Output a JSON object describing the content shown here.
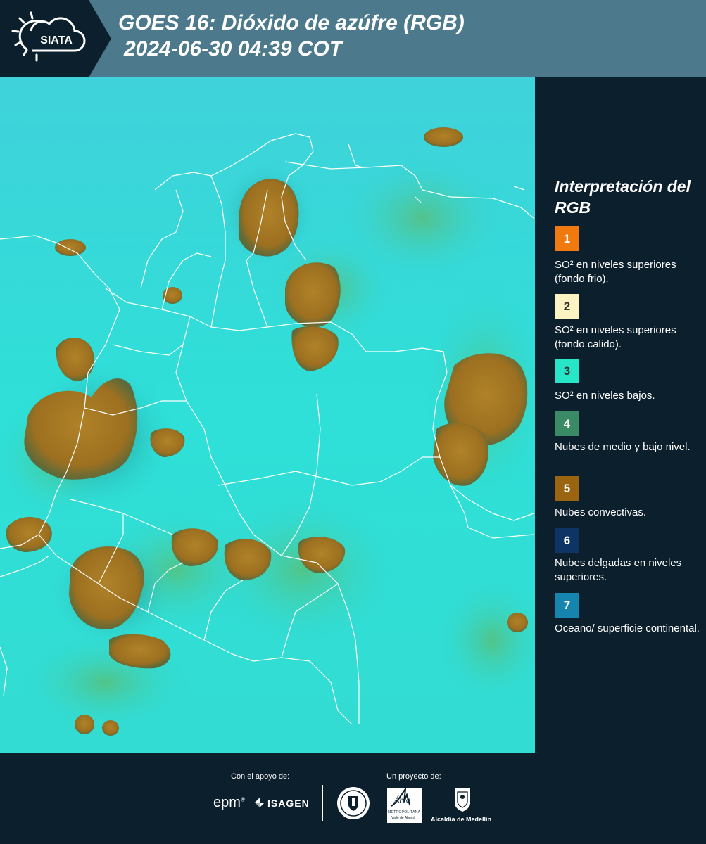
{
  "header": {
    "logo_text": "SIATA",
    "title_line1": "GOES 16: Dióxido de azúfre (RGB)",
    "title_line2": "2024-06-30 04:39 COT"
  },
  "legend": {
    "title": "Interpretación del RGB",
    "items": [
      {
        "number": "1",
        "color": "#f07a10",
        "label": "SO² en niveles superiores (fondo frio)."
      },
      {
        "number": "2",
        "color": "#fbf4c2",
        "label": "SO² en niveles superiores (fondo calido)."
      },
      {
        "number": "3",
        "color": "#27e6c8",
        "label": "SO² en niveles bajos."
      },
      {
        "number": "4",
        "color": "#3a8a66",
        "label": "Nubes de medio y bajo nivel."
      },
      {
        "number": "5",
        "color": "#9a6410",
        "label": "Nubes convectivas."
      },
      {
        "number": "6",
        "color": "#0e3466",
        "label": "Nubes delgadas en niveles superiores."
      },
      {
        "number": "7",
        "color": "#1585b0",
        "label": "Oceano/ superficie continental."
      }
    ]
  },
  "footer": {
    "support_label": "Con el apoyo de:",
    "project_label": "Un proyecto de:",
    "sponsor_epm": "epm",
    "sponsor_isagen": "ISAGEN",
    "partner_area_main": "Área",
    "partner_area_sub": "METROPOLITANA",
    "partner_area_sub2": "Valle de Aburrá",
    "partner_alcaldia": "Alcaldía de Medellín"
  },
  "colors": {
    "header_bg": "#4c7a8c",
    "panel_bg": "#0c1f2c",
    "map_background": "#2fd6d6",
    "convective_cloud": "#a87a20",
    "border_lines": "#ffffff"
  }
}
